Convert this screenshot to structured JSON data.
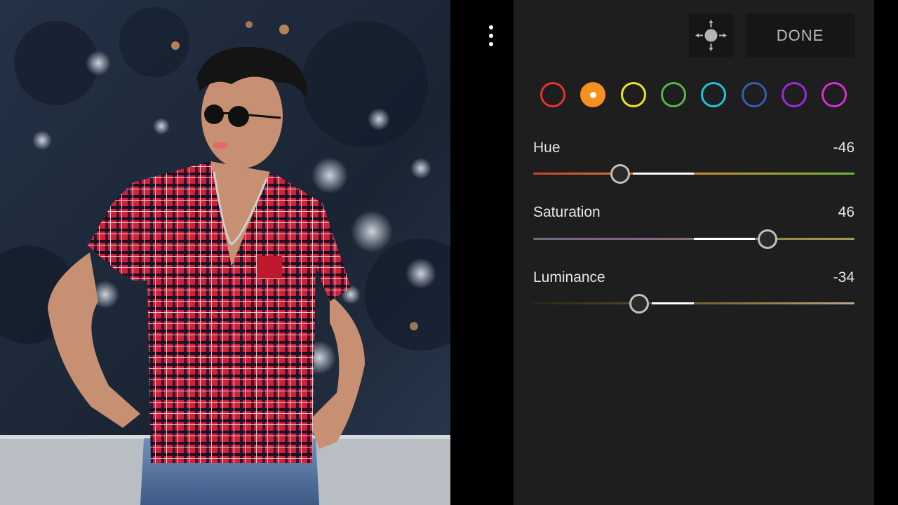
{
  "menu": {
    "icon": "more-vertical-icon"
  },
  "toolbar": {
    "target_icon": "target-adjust-icon",
    "done_label": "DONE"
  },
  "color_swatches": [
    {
      "name": "red",
      "color": "#e8322e",
      "selected": false
    },
    {
      "name": "orange",
      "color": "#f5911f",
      "selected": true
    },
    {
      "name": "yellow",
      "color": "#f1e21e",
      "selected": false
    },
    {
      "name": "green",
      "color": "#57b648",
      "selected": false
    },
    {
      "name": "aqua",
      "color": "#1ec5d8",
      "selected": false
    },
    {
      "name": "blue",
      "color": "#3a5cb4",
      "selected": false
    },
    {
      "name": "purple",
      "color": "#9b2bd8",
      "selected": false
    },
    {
      "name": "magenta",
      "color": "#d62fd6",
      "selected": false
    }
  ],
  "sliders": [
    {
      "label": "Hue",
      "value": "-46",
      "numeric": -46
    },
    {
      "label": "Saturation",
      "value": "46",
      "numeric": 46
    },
    {
      "label": "Luminance",
      "value": "-34",
      "numeric": -34
    }
  ],
  "photo": {
    "description_icon": "photo-preview-image"
  }
}
